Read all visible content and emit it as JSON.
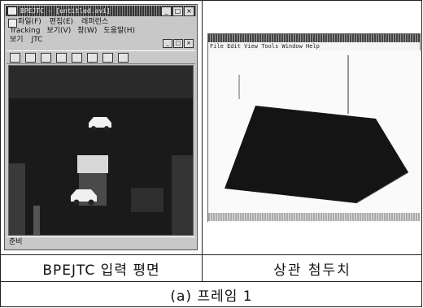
{
  "left_window": {
    "title": "BPEJTC - [untitled.avi]",
    "menu_file": "파일(F)",
    "menu_edit": "편집(E)",
    "menu_reference": "레퍼런스",
    "menu_tracking": "Tracking",
    "menu_view": "보기(V)",
    "menu_window": "창(W)",
    "menu_help": "도움말(H)",
    "menu_view2": "보기",
    "menu_jtc": "JTC",
    "status": "준비",
    "btn_min": "_",
    "btn_max": "□",
    "btn_close": "×"
  },
  "right_window": {
    "menu": "File  Edit  View  Tools  Window  Help"
  },
  "captions": {
    "left": "BPEJTC 입력 평면",
    "right": "상관 첨두치",
    "figure": "(a) 프레임 1"
  }
}
